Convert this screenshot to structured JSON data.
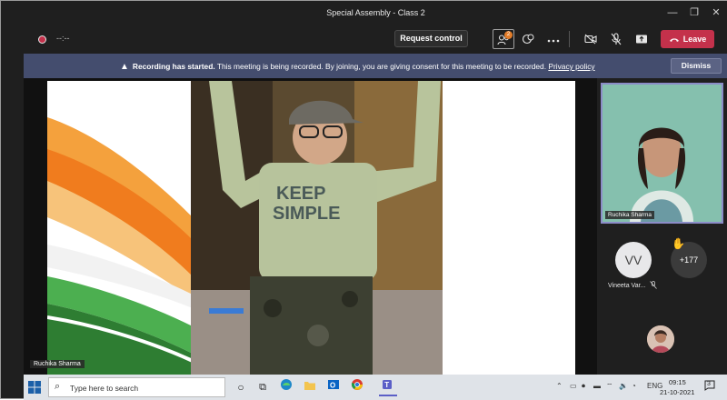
{
  "window": {
    "title": "Special Assembly - Class 2",
    "minimize_glyph": "—",
    "restore_glyph": "❐",
    "close_glyph": "✕"
  },
  "toolbar": {
    "timer": "--:--",
    "request_control_label": "Request control",
    "people_badge": "2",
    "leave_label": "Leave",
    "icons": [
      "people-icon",
      "reactions-icon",
      "more-actions-icon",
      "camera-off-icon",
      "mic-off-icon",
      "share-icon",
      "phone-icon"
    ]
  },
  "banner": {
    "bold_text": "Recording has started.",
    "text": " This meeting is being recorded. By joining, you are giving consent for this meeting to be recorded. ",
    "link_text": "Privacy policy",
    "dismiss_label": "Dismiss"
  },
  "stage": {
    "presenter_name": "Ruchika Sharma",
    "shirt_text_line1": "KEEP",
    "shirt_text_line2": "SIMPLE"
  },
  "participants": {
    "tile_name": "Ruchika Sharma",
    "vv_initials": "VV",
    "vv_name": "Vineeta Var...",
    "more_count": "+177"
  },
  "taskbar": {
    "search_placeholder": "Type here to search",
    "language": "ENG",
    "time": "09:15",
    "date": "21-10-2021",
    "notification_count": "3"
  },
  "colors": {
    "leave": "#c4314b",
    "banner": "#444d6e",
    "accent": "#5b5fc7"
  }
}
